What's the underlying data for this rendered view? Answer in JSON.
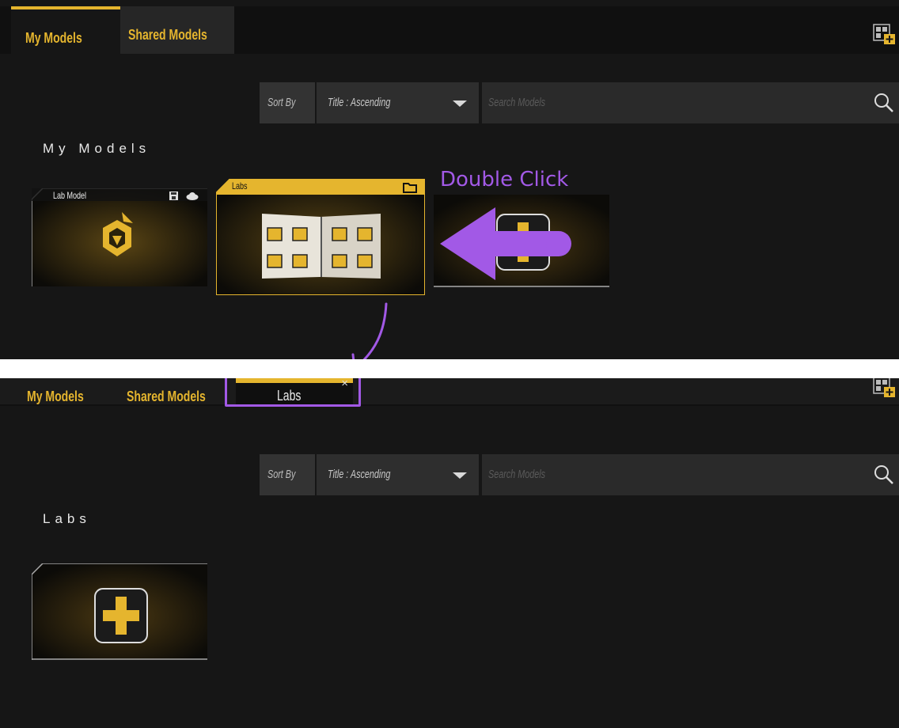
{
  "top": {
    "tabs": [
      {
        "label": "My Models",
        "active": true
      },
      {
        "label": "Shared Models",
        "active": false
      }
    ],
    "sort_label": "Sort By",
    "sort_value": "Title : Ascending",
    "search_placeholder": "Search Models",
    "section_title": "My Models",
    "cards": [
      {
        "label": "Lab Model",
        "kind": "model",
        "icons": [
          "save-icon",
          "cloud-icon"
        ]
      },
      {
        "label": "Labs",
        "kind": "folder",
        "selected": true,
        "icons": [
          "folder-icon"
        ]
      },
      {
        "label": "",
        "kind": "add-new"
      }
    ],
    "annotation": "Double Click"
  },
  "bottom": {
    "tabs": [
      {
        "label": "My Models",
        "active": false
      },
      {
        "label": "Shared Models",
        "active": false
      },
      {
        "label": "Labs",
        "active": true,
        "closable": true
      }
    ],
    "close_glyph": "×",
    "sort_label": "Sort By",
    "sort_value": "Title : Ascending",
    "search_placeholder": "Search Models",
    "section_title": "Labs",
    "cards": [
      {
        "label": "",
        "kind": "add-new"
      }
    ]
  },
  "colors": {
    "accent": "#e5b52e",
    "annotation": "#a259e6",
    "panel_bg": "#161616"
  }
}
